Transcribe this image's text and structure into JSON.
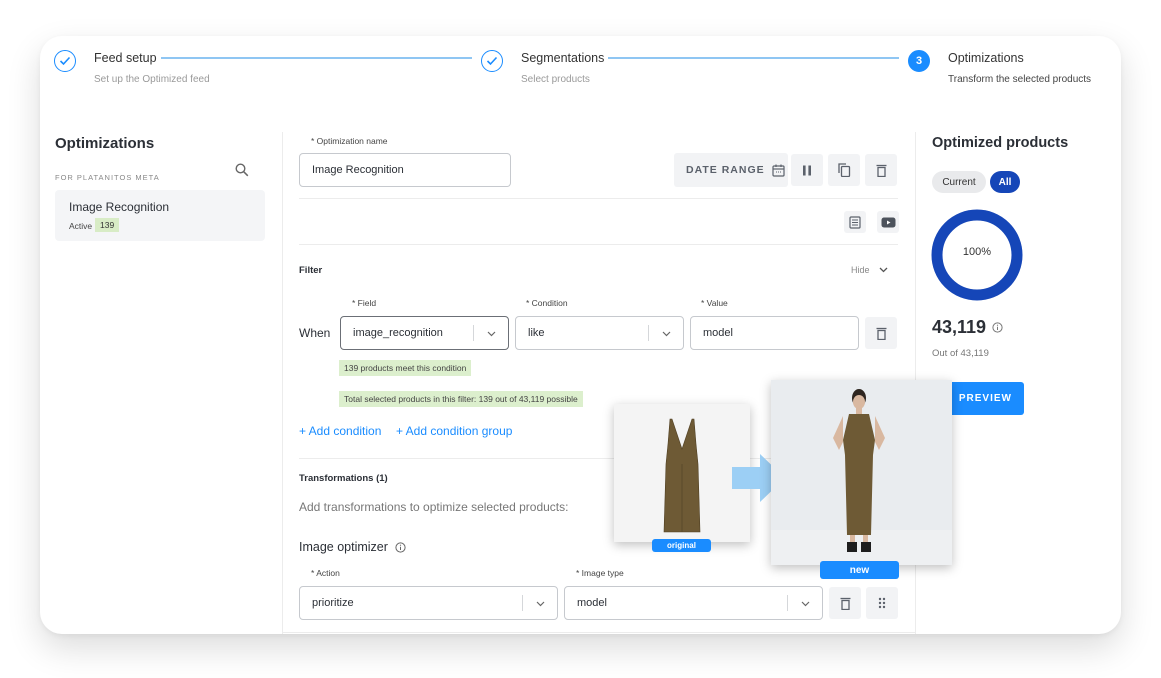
{
  "stepper": {
    "steps": [
      {
        "title": "Feed setup",
        "subtitle": "Set up the Optimized feed",
        "state": "done"
      },
      {
        "title": "Segmentations",
        "subtitle": "Select products",
        "state": "done"
      },
      {
        "title": "Optimizations",
        "subtitle": "Transform the selected products",
        "state": "active",
        "number": "3"
      }
    ]
  },
  "sidebar": {
    "title": "Optimizations",
    "subtitle": "FOR PLATANITOS META",
    "search_icon": "search-icon",
    "items": [
      {
        "name": "Image Recognition",
        "status": "Active",
        "count": "139"
      }
    ]
  },
  "main": {
    "name_label": "* Optimization name",
    "name_value": "Image Recognition",
    "date_range_label": "DATE RANGE",
    "toolbar_icons": [
      "calendar-icon",
      "pause-icon",
      "copy-icon",
      "trash-icon"
    ],
    "doc_icons": [
      "document-icon",
      "video-icon"
    ],
    "filter": {
      "title": "Filter",
      "hide_label": "Hide",
      "when_label": "When",
      "field_label": "* Field",
      "field_value": "image_recognition",
      "condition_label": "* Condition",
      "condition_value": "like",
      "value_label": "* Value",
      "value_value": "model",
      "match_note": "139 products meet this condition",
      "total_note": "Total selected products in this filter: 139 out of 43,119 possible",
      "add_condition": "+ Add condition",
      "add_condition_group": "+ Add condition group"
    },
    "transformations": {
      "title": "Transformations (1)",
      "description": "Add transformations to optimize selected products:",
      "optimizer_title": "Image optimizer",
      "action_label": "* Action",
      "action_value": "prioritize",
      "image_type_label": "* Image type",
      "image_type_value": "model"
    }
  },
  "right_panel": {
    "title": "Optimized products",
    "toggle": {
      "current": "Current",
      "all": "All",
      "selected": "all"
    },
    "percent_label": "100%",
    "percent_value": 100,
    "count": "43,119",
    "out_of": "Out of 43,119",
    "preview_label": "PREVIEW"
  },
  "overlay": {
    "original_tag": "original",
    "new_tag": "new"
  },
  "colors": {
    "accent": "#1a8cff",
    "donut": "#1546b8",
    "note_bg": "#dcefcd"
  }
}
